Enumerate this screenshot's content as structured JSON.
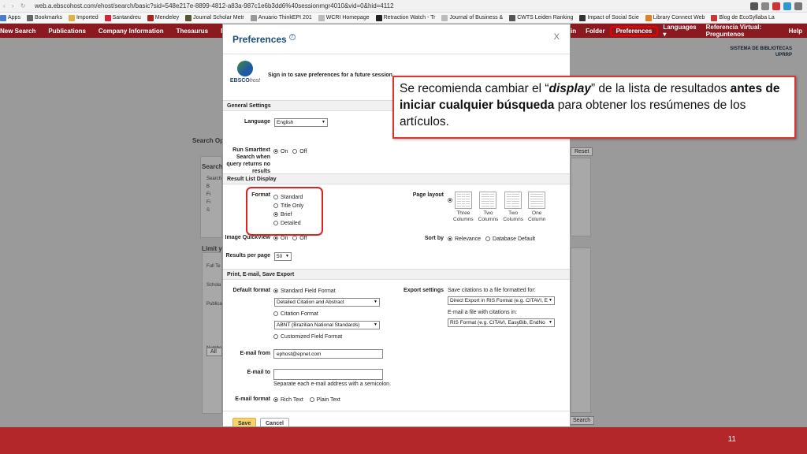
{
  "browser": {
    "url": "web.a.ebscohost.com/ehost/search/basic?sid=548e217e-8899-4812-a83a-987c1e6b3dd6%40sessionmgr4010&vid=0&hid=4112",
    "bookmarks": [
      "Apps",
      "Bookmarks",
      "Imported",
      "Santandreu",
      "Mendeley",
      "Journal Scholar Metr",
      "Anuario ThinkEPI 201",
      "WCRI Homepage",
      "Retraction Watch - Tr",
      "Journal of Business &",
      "CWTS Leiden Ranking",
      "Impact of Social Scie",
      "Library Connect Web",
      "Blog de EcoSyllaba La"
    ]
  },
  "ebsco_nav": {
    "left": [
      "New Search",
      "Publications",
      "Company Information",
      "Thesaurus",
      "More ▾"
    ],
    "right": [
      "in",
      "Folder",
      "Preferences",
      "Languages ▾",
      "Referencia Virtual: Preguntenos",
      "Help"
    ]
  },
  "background": {
    "sistema": "SISTEMA DE BIBLIOTECAS",
    "uprrp": "UPRRP",
    "search_op": "Search Op",
    "search": "Search",
    "search_items": [
      "Search",
      "B",
      "Fi",
      "Fi",
      "S"
    ],
    "limit": "Limit y",
    "limit_items": [
      "Full Te",
      "Schola",
      "Publica",
      "Numbe"
    ],
    "all": "All",
    "reset": "Reset",
    "search_btn": "Search"
  },
  "modal": {
    "title": "Preferences",
    "help": "?",
    "close": "X",
    "logo_main": "EBSCO",
    "logo_sub": "host",
    "sign_in": "Sign in to save preferences for a future session.",
    "general_settings": "General Settings",
    "language_label": "Language",
    "language_value": "English",
    "smarttext_label": "Run Smarttext Search when query returns no results",
    "on": "On",
    "off": "Off",
    "result_list_display": "Result List Display",
    "format_label": "Format",
    "format_options": [
      "Standard",
      "Title Only",
      "Brief",
      "Detailed"
    ],
    "image_quickview_label": "Image QuickView",
    "results_per_page_label": "Results per page",
    "results_per_page_value": "50",
    "page_layout_label": "Page layout",
    "layouts": [
      {
        "n1": "Three",
        "n2": "Columns"
      },
      {
        "n1": "Two",
        "n2": "Columns"
      },
      {
        "n1": "Two",
        "n2": "Columns"
      },
      {
        "n1": "One",
        "n2": "Column"
      }
    ],
    "sort_by_label": "Sort by",
    "sort_relevance": "Relevance",
    "sort_default": "Database Default",
    "print_section": "Print, E-mail, Save Export",
    "default_format_label": "Default format",
    "standard_field_format": "Standard Field Format",
    "detailed_citation": "Detailed Citation and Abstract",
    "citation_format": "Citation Format",
    "abnt": "ABNT (Brazilian National Standards)",
    "customized_field": "Customized Field Format",
    "export_settings_label": "Export settings",
    "save_citations": "Save citations to a file formatted for:",
    "direct_export": "Direct Export in RIS Format (e.g. CITAVI, E",
    "email_file": "E-mail a file with citations in:",
    "ris_format": "RIS Format (e.g. CITAVI, EasyBib, EndNo",
    "email_from_label": "E-mail from",
    "email_from_value": "ephost@epnet.com",
    "email_to_label": "E-mail to",
    "separate_note": "Separate each e-mail address with a semicolon.",
    "email_format_label": "E-mail format",
    "rich_text": "Rich Text",
    "plain_text": "Plain Text",
    "save": "Save",
    "cancel": "Cancel"
  },
  "callout": {
    "p1": "Se recomienda cambiar el “",
    "p2": "display",
    "p3": "” de la lista de resultados ",
    "p4": "antes de iniciar cualquier búsqueda",
    "p5": " para obtener los resúmenes de los artículos."
  },
  "slide": {
    "page_number": "11"
  },
  "colors": {
    "nav": "#8a1a1f",
    "footer": "#b3262a",
    "highlight": "#dd2222",
    "title": "#1a4d7a"
  }
}
